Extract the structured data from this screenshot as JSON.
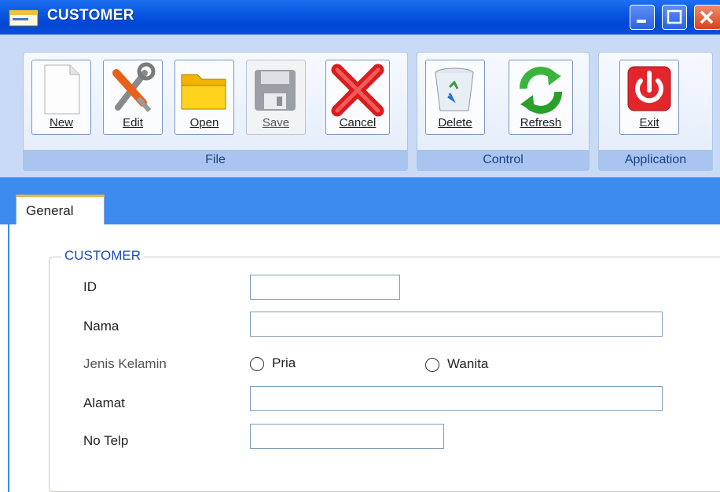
{
  "window": {
    "title": "CUSTOMER",
    "controls": [
      "minimize-icon",
      "maximize-icon",
      "close-icon"
    ]
  },
  "ribbon": {
    "groups": [
      {
        "label": "File",
        "buttons": [
          {
            "label": "New",
            "icon": "new-document-icon",
            "enabled": true
          },
          {
            "label": "Edit",
            "icon": "edit-tools-icon",
            "enabled": true
          },
          {
            "label": "Open",
            "icon": "folder-icon",
            "enabled": true
          },
          {
            "label": "Save",
            "icon": "floppy-disk-icon",
            "enabled": false
          },
          {
            "label": "Cancel",
            "icon": "red-x-icon",
            "enabled": true
          }
        ]
      },
      {
        "label": "Control",
        "buttons": [
          {
            "label": "Delete",
            "icon": "recycle-bin-icon",
            "enabled": true
          },
          {
            "label": "Refresh",
            "icon": "refresh-arrows-icon",
            "enabled": true
          }
        ]
      },
      {
        "label": "Application",
        "buttons": [
          {
            "label": "Exit",
            "icon": "power-icon",
            "enabled": true
          }
        ]
      }
    ]
  },
  "tabs": [
    {
      "label": "General",
      "active": true
    }
  ],
  "form": {
    "legend": "CUSTOMER",
    "fields": {
      "id": {
        "label": "ID",
        "value": ""
      },
      "nama": {
        "label": "Nama",
        "value": ""
      },
      "jenis_kelamin": {
        "label": "Jenis Kelamin",
        "options": [
          "Pria",
          "Wanita"
        ],
        "selected": null
      },
      "alamat": {
        "label": "Alamat",
        "value": ""
      },
      "no_telp": {
        "label": "No Telp",
        "value": ""
      }
    }
  },
  "colors": {
    "titlebar": "#0046d5",
    "ribbon": "#c8daf5",
    "group_label": "#a9c4ee",
    "tab_strip": "#3c8bef",
    "tab_accent": "#f3b33a",
    "legend_text": "#1d4bc0"
  }
}
